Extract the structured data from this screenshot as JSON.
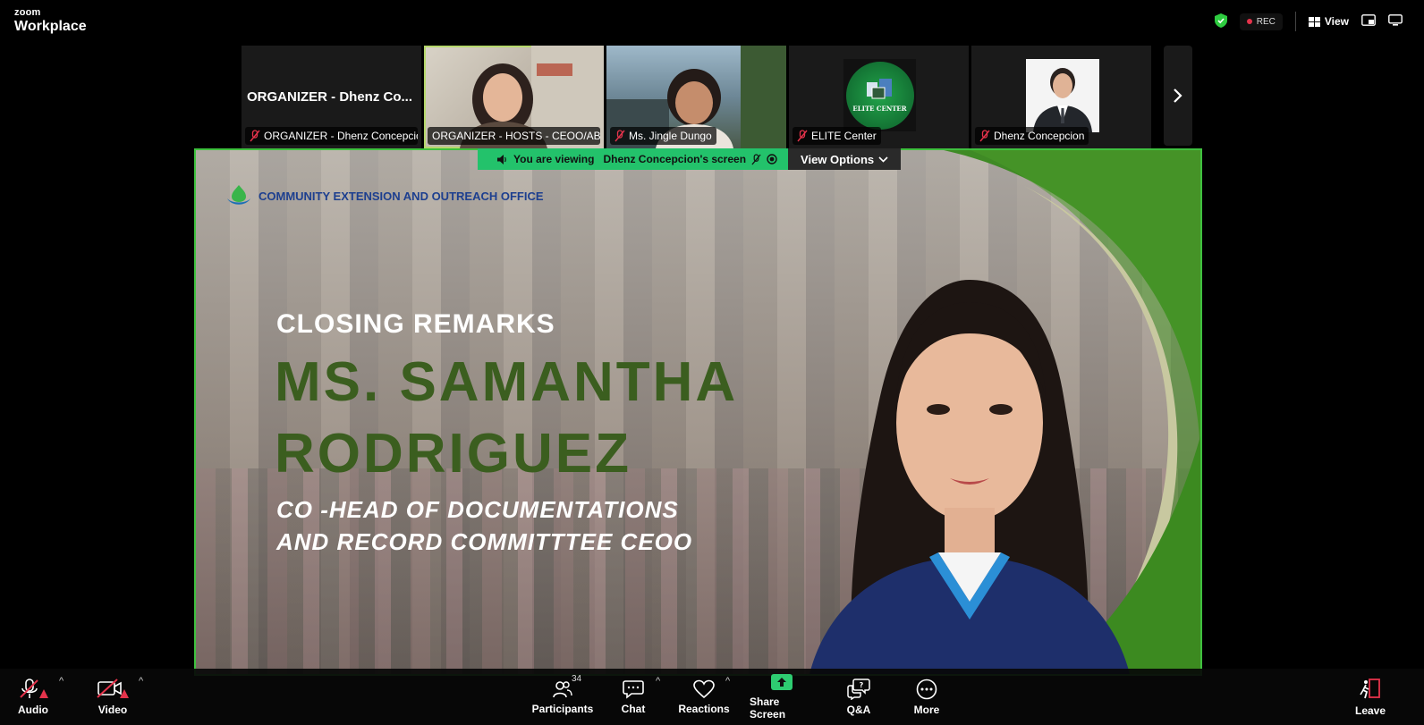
{
  "app": {
    "brand_top": "zoom",
    "brand_bottom": "Workplace"
  },
  "topbar": {
    "rec_label": "REC",
    "view_label": "View"
  },
  "participants_strip": [
    {
      "big_name": "ORGANIZER - Dhenz Co...",
      "label": "ORGANIZER - Dhenz Concepcio..."
    },
    {
      "label": "ORGANIZER - HOSTS - CEOO/AB..."
    },
    {
      "label": "Ms. Jingle Dungo"
    },
    {
      "label": "ELITE Center",
      "logo_text": "ELITE CENTER"
    },
    {
      "label": "Dhenz Concepcion"
    }
  ],
  "share_banner": {
    "viewing_prefix": "You are viewing",
    "viewing_name": "Dhenz Concepcion's screen",
    "view_options": "View Options"
  },
  "slide": {
    "office": "COMMUNITY EXTENSION AND OUTREACH OFFICE",
    "heading": "CLOSING REMARKS",
    "name_line1": "MS. SAMANTHA",
    "name_line2": "RODRIGUEZ",
    "role_line1": "CO -HEAD OF DOCUMENTATIONS",
    "role_line2": "AND RECORD COMMITTTEE CEOO"
  },
  "toolbar": {
    "audio": "Audio",
    "video": "Video",
    "participants": "Participants",
    "participants_count": "34",
    "chat": "Chat",
    "reactions": "Reactions",
    "share_screen": "Share Screen",
    "qa": "Q&A",
    "more": "More",
    "leave": "Leave"
  },
  "colors": {
    "accent_green": "#3fc13f",
    "banner_green": "#23c26b",
    "slide_green": "#3b5e1f",
    "alert_red": "#e5334b"
  }
}
